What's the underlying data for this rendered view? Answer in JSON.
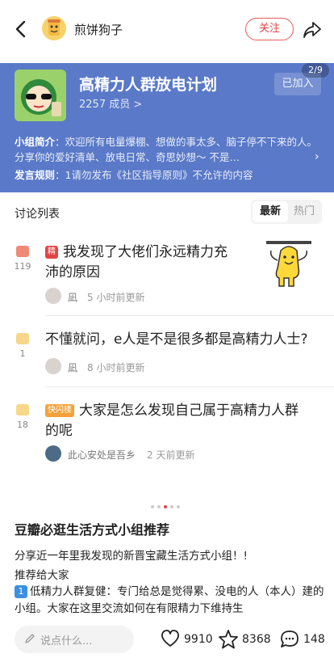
{
  "header": {
    "poster_name": "煎饼狗子",
    "follow_label": "关注"
  },
  "group": {
    "title": "高精力人群放电计划",
    "members": "2257 成员 >",
    "joined_label": "已加入",
    "page_indicator": "2/9",
    "intro_label": "小组简介",
    "intro_text": "：欢迎所有电量爆棚、想做的事太多、脑子停不下来的人。分享你的爱好清单、放电日常、奇思妙想～ 不是…",
    "rules_label": "发言规则",
    "rules_text": "：1请勿发布《社区指导原则》不允许的内容"
  },
  "discussion": {
    "title": "讨论列表",
    "sort_latest": "最新",
    "sort_hot": "热门",
    "posts": [
      {
        "tag": "精",
        "title_line1": "我发现了大佬们永远精力充",
        "title_line2": "沛的原因",
        "comments": "119",
        "author": "凪",
        "time": "5 小时前更新"
      },
      {
        "tag": "",
        "title_line1": "不懂就问，e人是不是很多都是高精力人士?",
        "title_line2": "",
        "comments": "1",
        "author": "凪",
        "time": "8 小时前更新"
      },
      {
        "tag": "快闪楼",
        "title_line1": "大家是怎么发现自己属于高精力人群",
        "title_line2": "的呢",
        "comments": "18",
        "author": "此心安处是吾乡",
        "time": "2 天前更新"
      }
    ]
  },
  "article": {
    "title": "豆瓣必逛生活方式小组推荐",
    "p1": "分享近一年里我发现的新晋宝藏生活方式小组！!",
    "p2": "推荐给大家",
    "num": "1",
    "p3": "低精力人群复健：专门给总是觉得累、没电的人（本人）建的小组。大家在这里交流如何在有限精力下维持生"
  },
  "bottom": {
    "comment_placeholder": "说点什么...",
    "likes": "9910",
    "stars": "8368",
    "comments": "148"
  },
  "colors": {
    "banner": "#5a79c8",
    "accent_red": "#e14646",
    "flash_tag": "#f4a23b"
  },
  "icons": [
    "back-icon",
    "share-icon",
    "comment-bubble-icon",
    "pen-icon",
    "heart-icon",
    "star-icon",
    "chat-icon"
  ]
}
